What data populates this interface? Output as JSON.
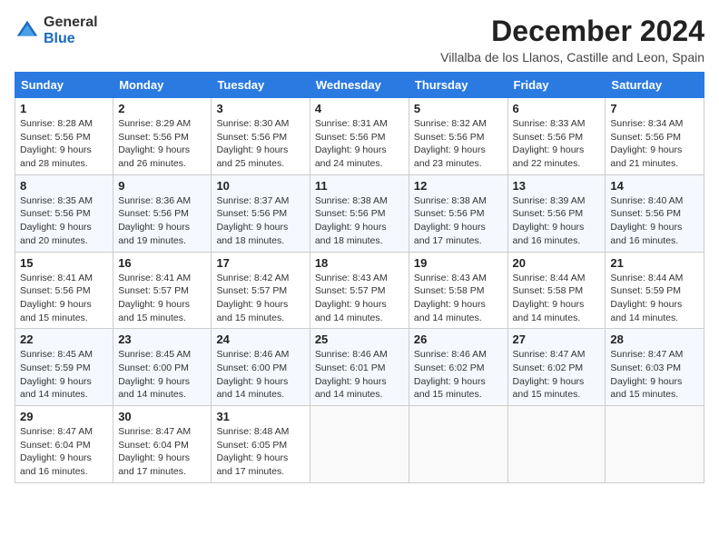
{
  "logo": {
    "general": "General",
    "blue": "Blue"
  },
  "title": "December 2024",
  "location": "Villalba de los Llanos, Castille and Leon, Spain",
  "days_of_week": [
    "Sunday",
    "Monday",
    "Tuesday",
    "Wednesday",
    "Thursday",
    "Friday",
    "Saturday"
  ],
  "weeks": [
    [
      {
        "day": 1,
        "sunrise": "8:28 AM",
        "sunset": "5:56 PM",
        "daylight": "9 hours and 28 minutes."
      },
      {
        "day": 2,
        "sunrise": "8:29 AM",
        "sunset": "5:56 PM",
        "daylight": "9 hours and 26 minutes."
      },
      {
        "day": 3,
        "sunrise": "8:30 AM",
        "sunset": "5:56 PM",
        "daylight": "9 hours and 25 minutes."
      },
      {
        "day": 4,
        "sunrise": "8:31 AM",
        "sunset": "5:56 PM",
        "daylight": "9 hours and 24 minutes."
      },
      {
        "day": 5,
        "sunrise": "8:32 AM",
        "sunset": "5:56 PM",
        "daylight": "9 hours and 23 minutes."
      },
      {
        "day": 6,
        "sunrise": "8:33 AM",
        "sunset": "5:56 PM",
        "daylight": "9 hours and 22 minutes."
      },
      {
        "day": 7,
        "sunrise": "8:34 AM",
        "sunset": "5:56 PM",
        "daylight": "9 hours and 21 minutes."
      }
    ],
    [
      {
        "day": 8,
        "sunrise": "8:35 AM",
        "sunset": "5:56 PM",
        "daylight": "9 hours and 20 minutes."
      },
      {
        "day": 9,
        "sunrise": "8:36 AM",
        "sunset": "5:56 PM",
        "daylight": "9 hours and 19 minutes."
      },
      {
        "day": 10,
        "sunrise": "8:37 AM",
        "sunset": "5:56 PM",
        "daylight": "9 hours and 18 minutes."
      },
      {
        "day": 11,
        "sunrise": "8:38 AM",
        "sunset": "5:56 PM",
        "daylight": "9 hours and 18 minutes."
      },
      {
        "day": 12,
        "sunrise": "8:38 AM",
        "sunset": "5:56 PM",
        "daylight": "9 hours and 17 minutes."
      },
      {
        "day": 13,
        "sunrise": "8:39 AM",
        "sunset": "5:56 PM",
        "daylight": "9 hours and 16 minutes."
      },
      {
        "day": 14,
        "sunrise": "8:40 AM",
        "sunset": "5:56 PM",
        "daylight": "9 hours and 16 minutes."
      }
    ],
    [
      {
        "day": 15,
        "sunrise": "8:41 AM",
        "sunset": "5:56 PM",
        "daylight": "9 hours and 15 minutes."
      },
      {
        "day": 16,
        "sunrise": "8:41 AM",
        "sunset": "5:57 PM",
        "daylight": "9 hours and 15 minutes."
      },
      {
        "day": 17,
        "sunrise": "8:42 AM",
        "sunset": "5:57 PM",
        "daylight": "9 hours and 15 minutes."
      },
      {
        "day": 18,
        "sunrise": "8:43 AM",
        "sunset": "5:57 PM",
        "daylight": "9 hours and 14 minutes."
      },
      {
        "day": 19,
        "sunrise": "8:43 AM",
        "sunset": "5:58 PM",
        "daylight": "9 hours and 14 minutes."
      },
      {
        "day": 20,
        "sunrise": "8:44 AM",
        "sunset": "5:58 PM",
        "daylight": "9 hours and 14 minutes."
      },
      {
        "day": 21,
        "sunrise": "8:44 AM",
        "sunset": "5:59 PM",
        "daylight": "9 hours and 14 minutes."
      }
    ],
    [
      {
        "day": 22,
        "sunrise": "8:45 AM",
        "sunset": "5:59 PM",
        "daylight": "9 hours and 14 minutes."
      },
      {
        "day": 23,
        "sunrise": "8:45 AM",
        "sunset": "6:00 PM",
        "daylight": "9 hours and 14 minutes."
      },
      {
        "day": 24,
        "sunrise": "8:46 AM",
        "sunset": "6:00 PM",
        "daylight": "9 hours and 14 minutes."
      },
      {
        "day": 25,
        "sunrise": "8:46 AM",
        "sunset": "6:01 PM",
        "daylight": "9 hours and 14 minutes."
      },
      {
        "day": 26,
        "sunrise": "8:46 AM",
        "sunset": "6:02 PM",
        "daylight": "9 hours and 15 minutes."
      },
      {
        "day": 27,
        "sunrise": "8:47 AM",
        "sunset": "6:02 PM",
        "daylight": "9 hours and 15 minutes."
      },
      {
        "day": 28,
        "sunrise": "8:47 AM",
        "sunset": "6:03 PM",
        "daylight": "9 hours and 15 minutes."
      }
    ],
    [
      {
        "day": 29,
        "sunrise": "8:47 AM",
        "sunset": "6:04 PM",
        "daylight": "9 hours and 16 minutes."
      },
      {
        "day": 30,
        "sunrise": "8:47 AM",
        "sunset": "6:04 PM",
        "daylight": "9 hours and 17 minutes."
      },
      {
        "day": 31,
        "sunrise": "8:48 AM",
        "sunset": "6:05 PM",
        "daylight": "9 hours and 17 minutes."
      },
      null,
      null,
      null,
      null
    ]
  ]
}
